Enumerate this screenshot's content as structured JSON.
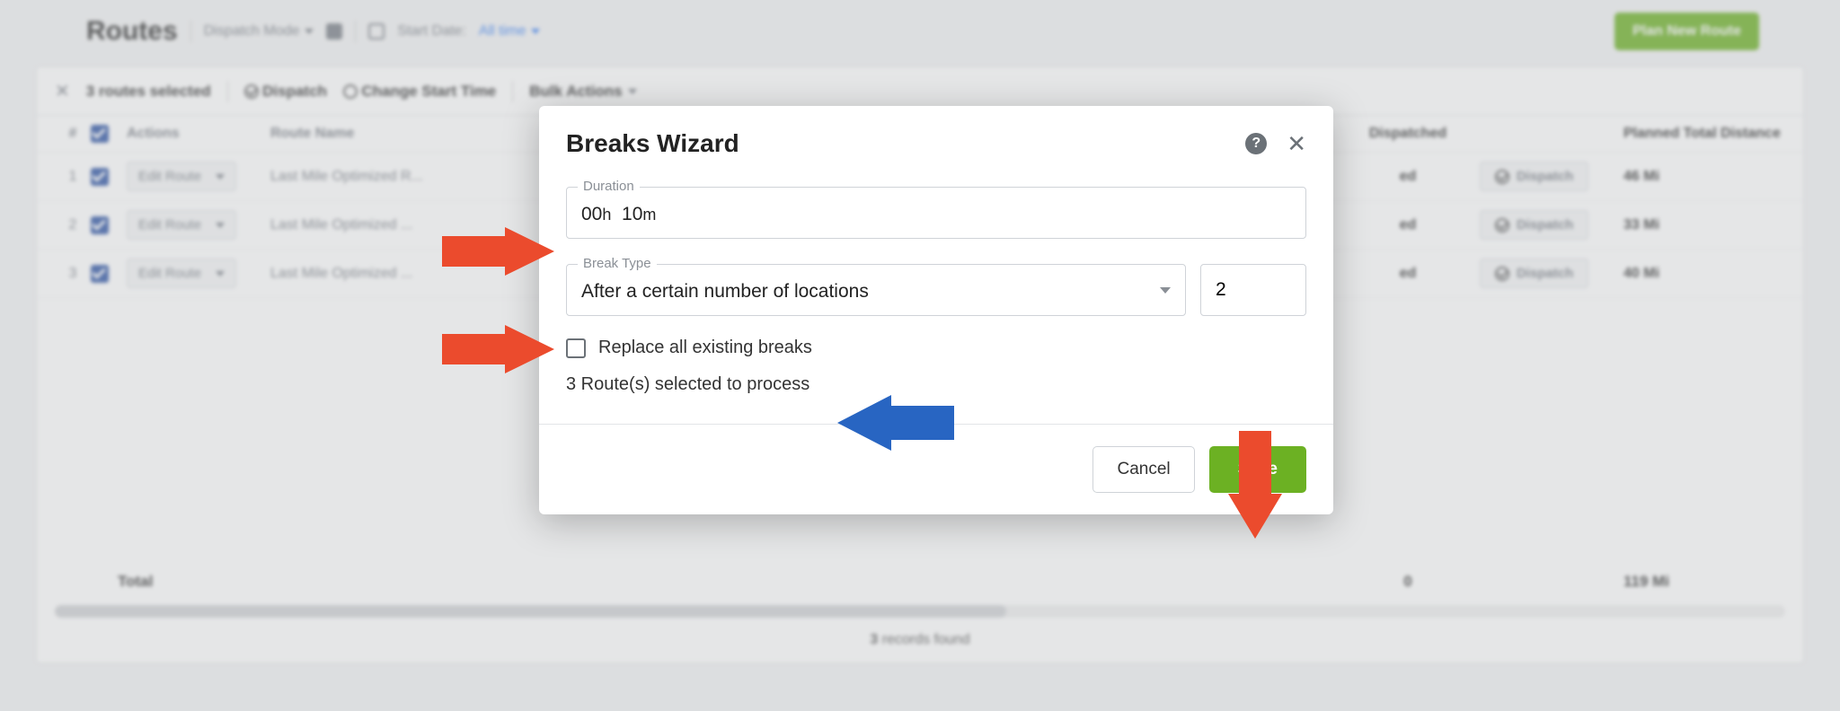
{
  "header": {
    "title": "Routes",
    "dispatch_mode_label": "Dispatch Mode",
    "start_date_label": "Start Date:",
    "start_date_value": "All time",
    "plan_button": "Plan New Route"
  },
  "selection_bar": {
    "selected_text": "3 routes selected",
    "dispatch_label": "Dispatch",
    "change_time_label": "Change Start Time",
    "bulk_actions_label": "Bulk Actions"
  },
  "table": {
    "headers": {
      "num": "#",
      "actions": "Actions",
      "route_name": "Route Name",
      "dispatched": "Dispatched",
      "distance": "Planned Total Distance"
    },
    "edit_label": "Edit Route",
    "dispatch_btn_label": "Dispatch",
    "rows": [
      {
        "num": "1",
        "name": "Last Mile Optimized R...",
        "dispatched": "ed",
        "distance": "46 Mi"
      },
      {
        "num": "2",
        "name": "Last Mile Optimized ...",
        "dispatched": "ed",
        "distance": "33 Mi"
      },
      {
        "num": "3",
        "name": "Last Mile Optimized ...",
        "dispatched": "ed",
        "distance": "40 Mi"
      }
    ],
    "total_label": "Total",
    "total_dispatched": "0",
    "total_distance": "119 Mi",
    "records_found_prefix": "3",
    "records_found_suffix": " records found"
  },
  "modal": {
    "title": "Breaks Wizard",
    "duration_legend": "Duration",
    "duration_hours": "00",
    "duration_hours_unit": "h",
    "duration_minutes": "10",
    "duration_minutes_unit": "m",
    "break_type_legend": "Break Type",
    "break_type_value": "After a certain number of locations",
    "break_type_number": "2",
    "replace_label": "Replace all existing breaks",
    "process_info": "3 Route(s) selected to process",
    "cancel": "Cancel",
    "save": "Save"
  },
  "annotations": {
    "arrow1_color": "#eb4b2d",
    "arrow2_color": "#eb4b2d",
    "arrow3_color": "#2865c2",
    "arrow4_color": "#eb4b2d"
  }
}
